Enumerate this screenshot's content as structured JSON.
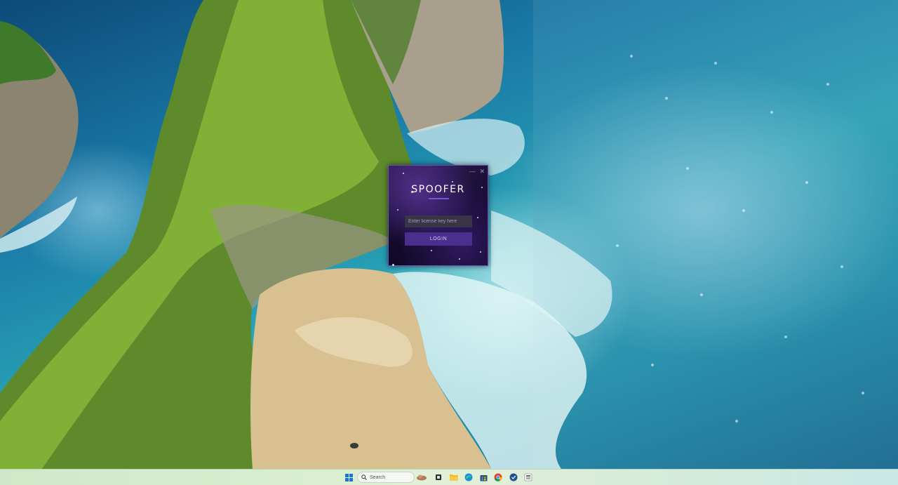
{
  "login_window": {
    "title": "SPOOFER",
    "license_placeholder": "Enter license key here",
    "login_label": "LOGIN",
    "minimize_glyph": "—",
    "close_glyph": "✕",
    "accent_color": "#7a55d8",
    "button_color": "#4a2f8f"
  },
  "taskbar": {
    "search_placeholder": "Search",
    "icons": [
      "start-icon",
      "search-icon",
      "weather-widget-icon",
      "task-view-icon",
      "file-explorer-icon",
      "edge-icon",
      "store-icon",
      "chrome-icon",
      "app-icon",
      "spoofer-app-icon"
    ]
  }
}
